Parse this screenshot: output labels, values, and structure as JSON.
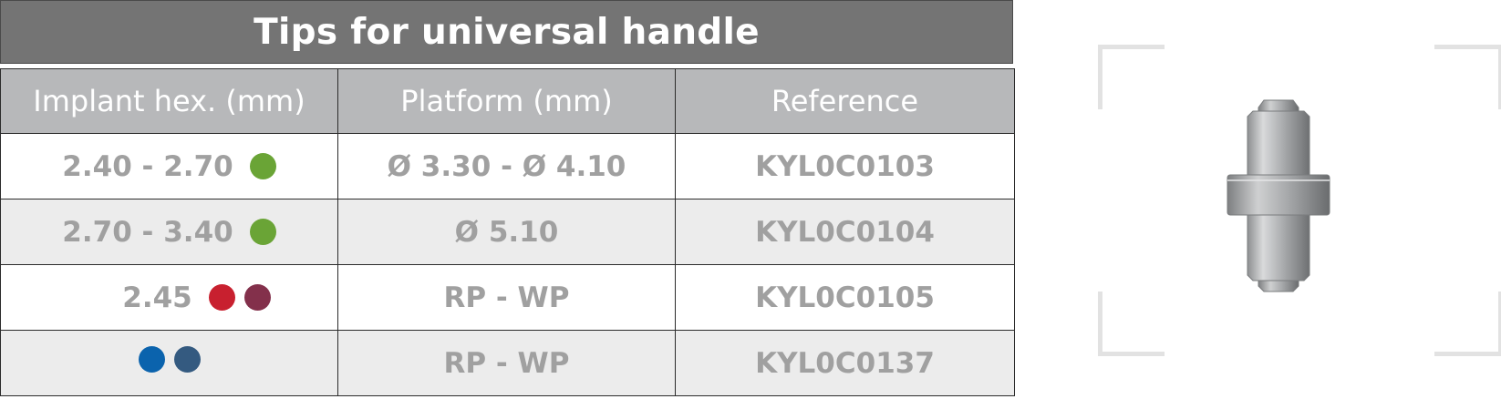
{
  "title": "Tips for universal handle",
  "table": {
    "headers": [
      "Implant hex. (mm)",
      "Platform (mm)",
      "Reference"
    ],
    "rows": [
      {
        "hex": "2.40 - 2.70",
        "dots": [
          "#6aa436"
        ],
        "platform": "Ø 3.30 - Ø 4.10",
        "reference": "KYL0C0103"
      },
      {
        "hex": "2.70 - 3.40",
        "dots": [
          "#6aa436"
        ],
        "platform": "Ø 5.10",
        "reference": "KYL0C0104"
      },
      {
        "hex": "2.45",
        "dots": [
          "#c8202f",
          "#83304b"
        ],
        "platform": "RP - WP",
        "reference": "KYL0C0105"
      },
      {
        "hex": "",
        "dots": [
          "#0b63ad",
          "#345a80"
        ],
        "platform": "RP - WP",
        "reference": "KYL0C0137"
      }
    ]
  },
  "colors": {
    "title_bg": "#747474",
    "header_bg": "#b7b8ba",
    "cell_text": "#a0a0a0",
    "alt_row_bg": "#ececec"
  },
  "product_image": {
    "icon": "universal-handle-tip-image"
  }
}
